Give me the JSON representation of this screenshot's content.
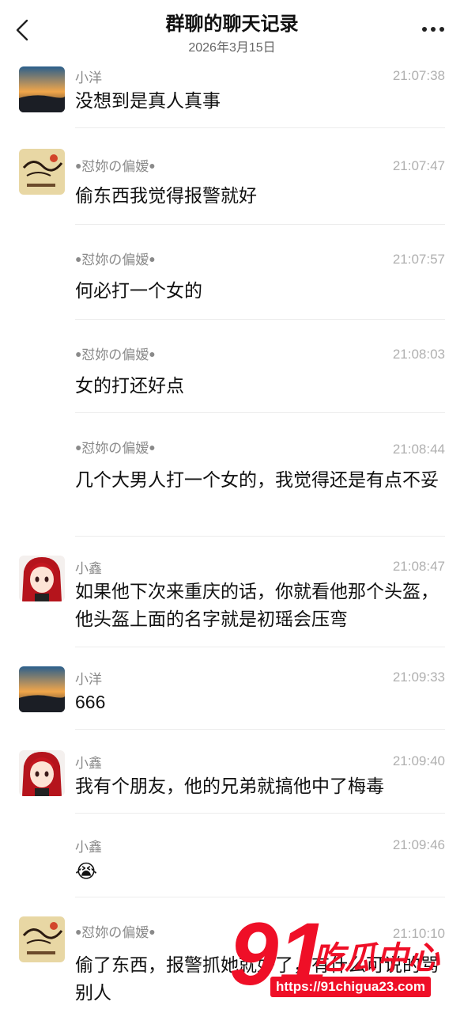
{
  "header": {
    "title": "群聊的聊天记录",
    "date": "2026年3月15日",
    "back_icon": "chevron-left-icon",
    "more_icon": "more-horizontal-icon"
  },
  "messages": [
    {
      "sender": "小洋",
      "time": "21:07:38",
      "text": "没想到是真人真事",
      "avatar": "sunset-avatar"
    },
    {
      "sender": "ꔷ怼妳の偏嫒ꔷ",
      "time": "21:07:47",
      "text": "偷东西我觉得报警就好",
      "avatar": "calligraphy-avatar"
    },
    {
      "sender": "ꔷ怼妳の偏嫒ꔷ",
      "time": "21:07:57",
      "text": "何必打一个女的"
    },
    {
      "sender": "ꔷ怼妳の偏嫒ꔷ",
      "time": "21:08:03",
      "text": "女的打还好点"
    },
    {
      "sender": "ꔷ怼妳の偏嫒ꔷ",
      "time": "21:08:44",
      "text": "几个大男人打一个女的，我觉得还是有点不妥"
    },
    {
      "sender": "小鑫",
      "time": "21:08:47",
      "text": "如果他下次来重庆的话，你就看他那个头盔，他头盔上面的名字就是初瑶会压弯",
      "avatar": "anime-girl-avatar"
    },
    {
      "sender": "小洋",
      "time": "21:09:33",
      "text": "666",
      "avatar": "sunset-avatar"
    },
    {
      "sender": "小鑫",
      "time": "21:09:40",
      "text": "我有个朋友，他的兄弟就搞他中了梅毒",
      "avatar": "anime-girl-avatar"
    },
    {
      "sender": "小鑫",
      "time": "21:09:46",
      "text": "😭"
    },
    {
      "sender": "ꔷ怼妳の偏嫒ꔷ",
      "time": "21:10:10",
      "text": "偷了东西，报警抓她就好了，有什么可说的骂别人",
      "avatar": "calligraphy-avatar"
    }
  ],
  "watermark": {
    "number": "91",
    "brand": "吃瓜中心",
    "url": "https://91chigua23.com"
  }
}
